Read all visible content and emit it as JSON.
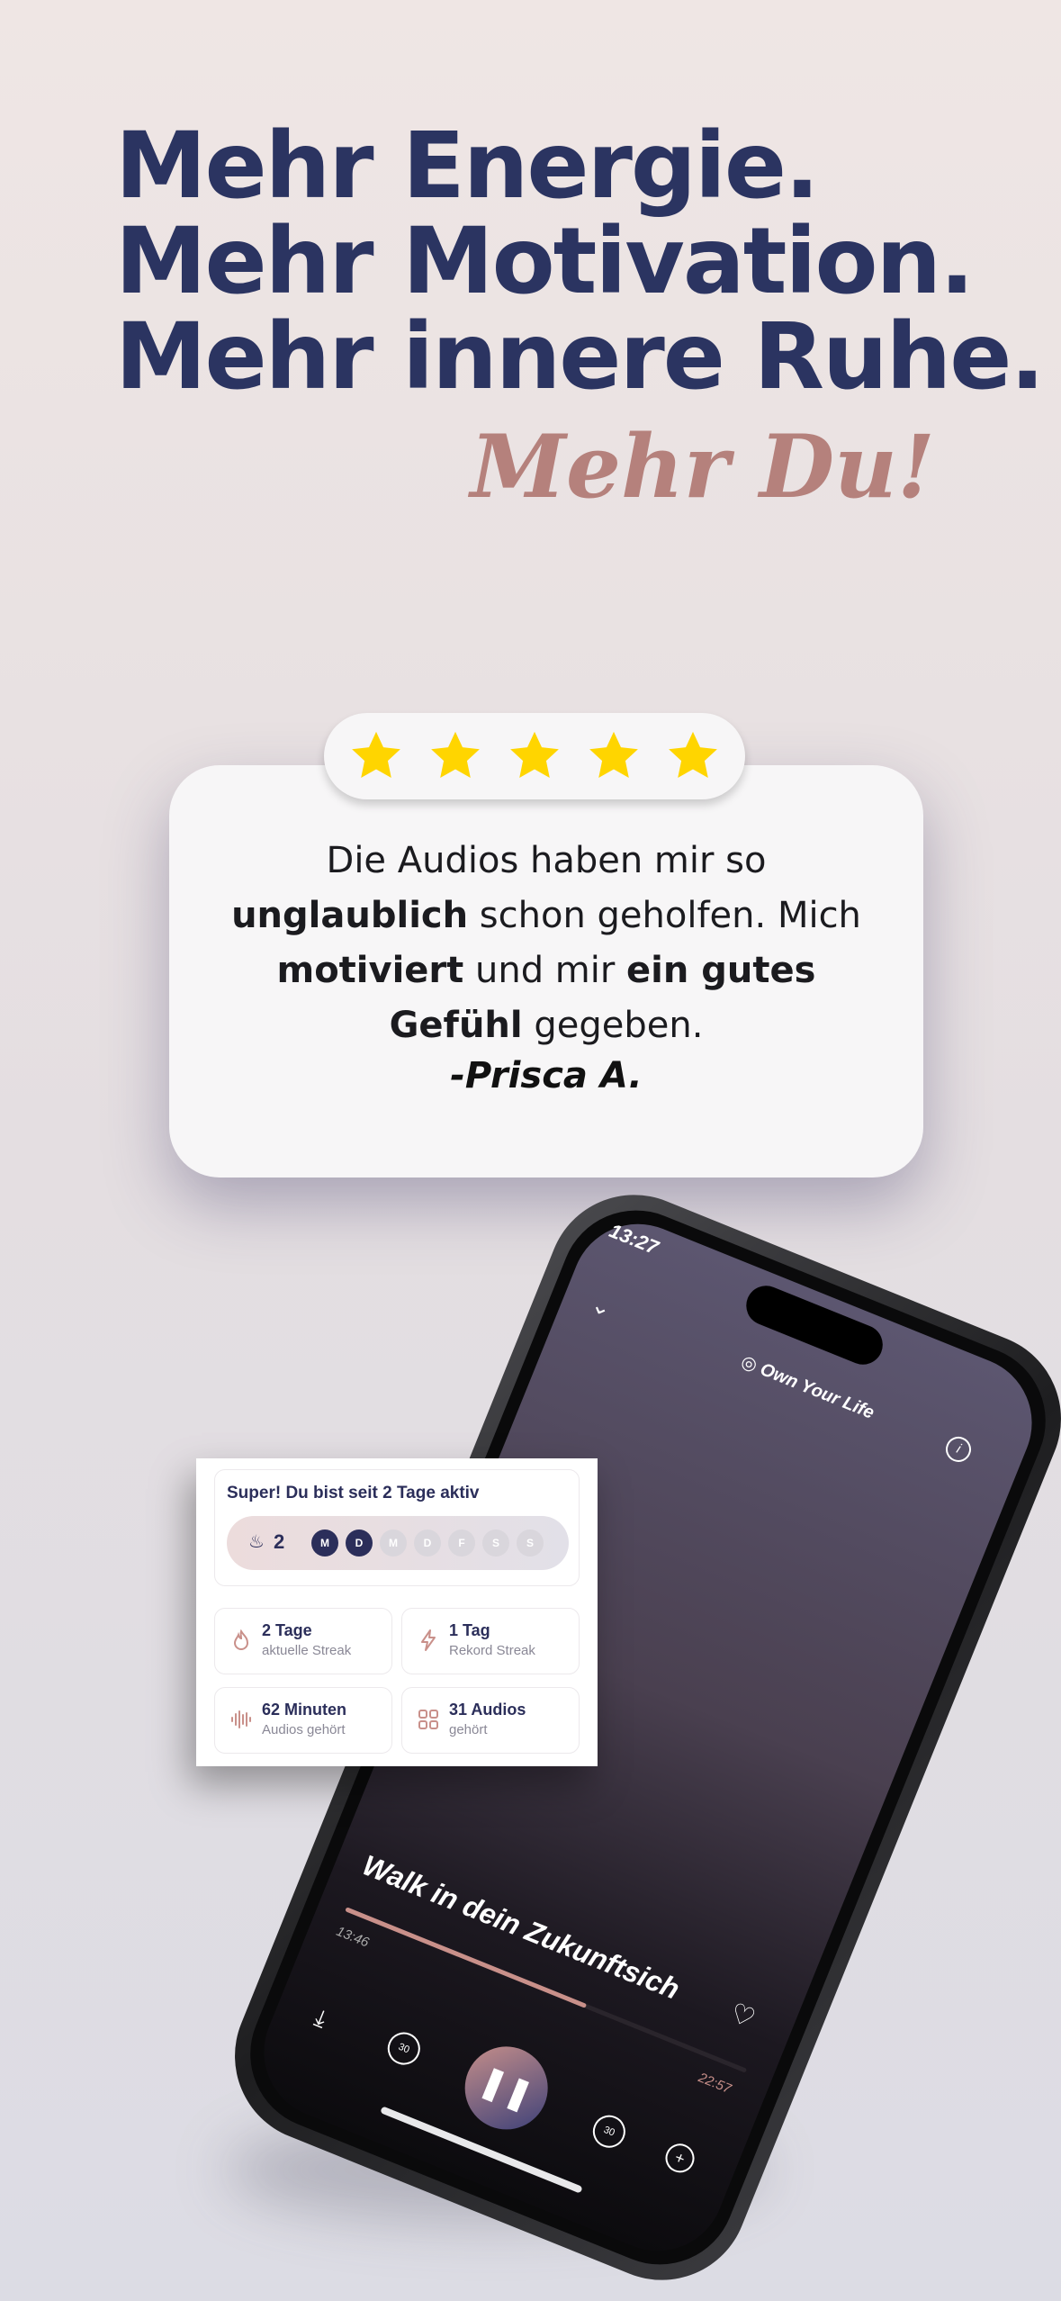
{
  "headline": {
    "line1": "Mehr Energie.",
    "line2": "Mehr Motivation.",
    "line3": "Mehr innere Ruhe.",
    "tagline": "Mehr Du!"
  },
  "review": {
    "rating": 5,
    "text_parts": [
      "Die Audios haben mir so ",
      "unglaublich",
      " schon geholfen. Mich ",
      "motiviert",
      " und mir ",
      "ein gutes Gefühl",
      " gegeben."
    ],
    "author": "-Prisca A."
  },
  "phone": {
    "clock": "13:27",
    "brand": "Own Your Life",
    "track_title": "Walk in dein Zukunftsich",
    "elapsed": "13:46",
    "total": "22:57",
    "progress": 0.6,
    "skip_seconds": "30"
  },
  "stats": {
    "title": "Super! Du bist seit 2 Tage aktiv",
    "streak_count": "2",
    "days": [
      {
        "label": "M",
        "active": true
      },
      {
        "label": "D",
        "active": true
      },
      {
        "label": "M",
        "active": false
      },
      {
        "label": "D",
        "active": false
      },
      {
        "label": "F",
        "active": false
      },
      {
        "label": "S",
        "active": false
      },
      {
        "label": "S",
        "active": false
      }
    ],
    "tiles": [
      {
        "value": "2 Tage",
        "label": "aktuelle Streak",
        "icon": "flame-icon"
      },
      {
        "value": "1 Tag",
        "label": "Rekord Streak",
        "icon": "lightning-icon"
      },
      {
        "value": "62 Minuten",
        "label": "Audios gehört",
        "icon": "waveform-icon"
      },
      {
        "value": "31 Audios",
        "label": "gehört",
        "icon": "grid-icon"
      }
    ]
  },
  "colors": {
    "navy": "#2b3461",
    "rose": "#b5817c",
    "star": "#ffd500",
    "progress": "#c9908a"
  }
}
